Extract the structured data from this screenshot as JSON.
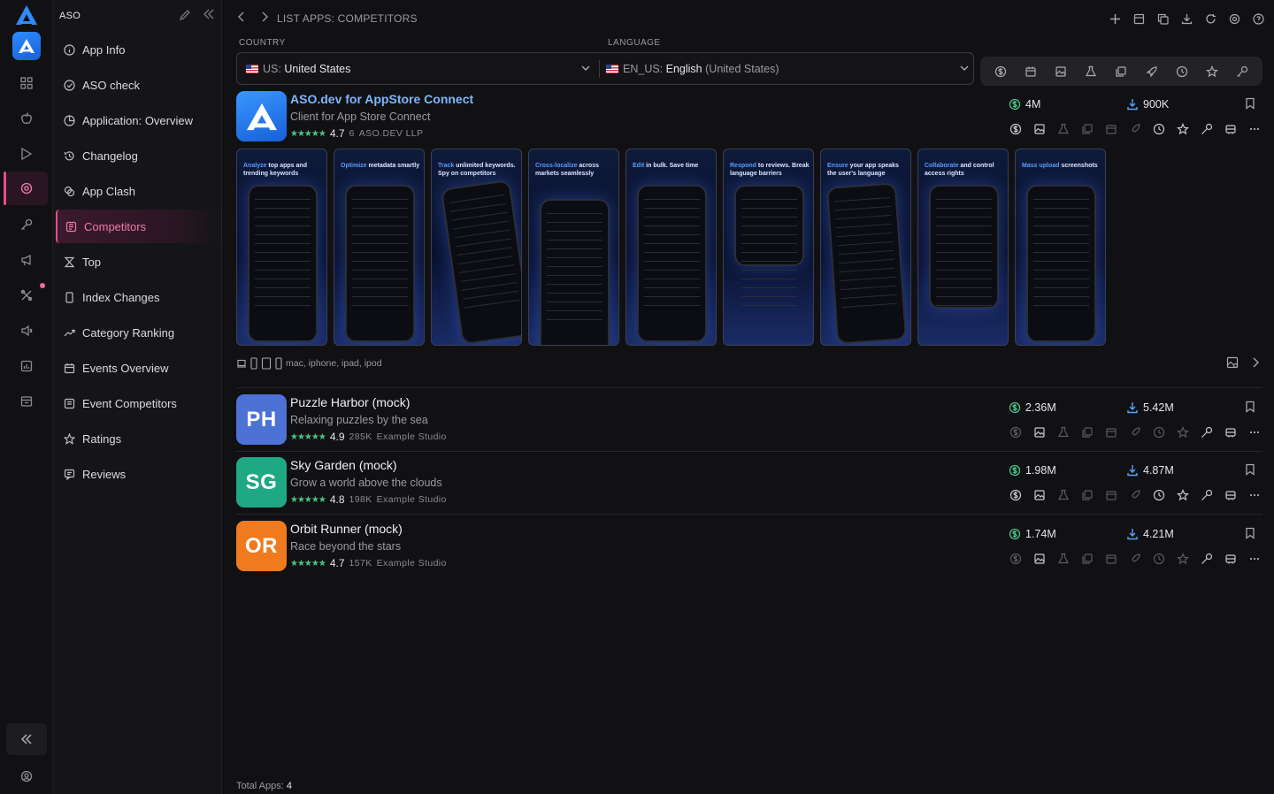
{
  "sidebar": {
    "title": "ASO",
    "items": [
      {
        "label": "App Info",
        "icon": "info-icon",
        "active": false
      },
      {
        "label": "ASO check",
        "icon": "check-circle-icon",
        "active": false
      },
      {
        "label": "Application: Overview",
        "icon": "pie-chart-icon",
        "active": false
      },
      {
        "label": "Changelog",
        "icon": "history-icon",
        "active": false
      },
      {
        "label": "App Clash",
        "icon": "versus-icon",
        "active": false
      },
      {
        "label": "Competitors",
        "icon": "competitors-icon",
        "active": true
      },
      {
        "label": "Top",
        "icon": "trophy-icon",
        "active": false
      },
      {
        "label": "Index Changes",
        "icon": "phone-icon",
        "active": false
      },
      {
        "label": "Category Ranking",
        "icon": "trend-icon",
        "active": false
      },
      {
        "label": "Events Overview",
        "icon": "calendar-icon",
        "active": false
      },
      {
        "label": "Event Competitors",
        "icon": "calendar-compare-icon",
        "active": false
      },
      {
        "label": "Ratings",
        "icon": "star-icon",
        "active": false
      },
      {
        "label": "Reviews",
        "icon": "review-icon",
        "active": false
      }
    ]
  },
  "header": {
    "breadcrumb": "LIST APPS: COMPETITORS"
  },
  "filters": {
    "country_label": "COUNTRY",
    "language_label": "LANGUAGE",
    "country_code": "US:",
    "country_value": "United States",
    "language_code": "EN_US:",
    "language_value": "English",
    "language_region": "(United States)"
  },
  "apps": [
    {
      "initials": "",
      "name": "ASO.dev for AppStore Connect",
      "subtitle": "Client for App Store Connect",
      "stars": "★★★★★",
      "rating": "4.7",
      "reviews": "6",
      "developer": "ASO.DEV LLP",
      "revenue": "4M",
      "downloads": "900K",
      "color": "#1e6fe6"
    },
    {
      "initials": "PH",
      "name": "Puzzle Harbor (mock)",
      "subtitle": "Relaxing puzzles by the sea",
      "stars": "★★★★★",
      "rating": "4.9",
      "reviews": "285K",
      "developer": "Example Studio",
      "revenue": "2.36M",
      "downloads": "5.42M",
      "color": "#4d72d6"
    },
    {
      "initials": "SG",
      "name": "Sky Garden (mock)",
      "subtitle": "Grow a world above the clouds",
      "stars": "★★★★★",
      "rating": "4.8",
      "reviews": "198K",
      "developer": "Example Studio",
      "revenue": "1.98M",
      "downloads": "4.87M",
      "color": "#1fa884"
    },
    {
      "initials": "OR",
      "name": "Orbit Runner (mock)",
      "subtitle": "Race beyond the stars",
      "stars": "★★★★★",
      "rating": "4.7",
      "reviews": "157K",
      "developer": "Example Studio",
      "revenue": "1.74M",
      "downloads": "4.21M",
      "color": "#f07a1e"
    }
  ],
  "screenshots": [
    {
      "pre": "Analyze",
      "rest": " top apps and trending keywords"
    },
    {
      "pre": "Optimize",
      "rest": " metadata smartly"
    },
    {
      "pre": "Track",
      "rest": " unlimited keywords. Spy on competitors"
    },
    {
      "pre": "Cross-localize",
      "rest": " across markets seamlessly"
    },
    {
      "pre": "Edit",
      "rest": " in bulk. Save time"
    },
    {
      "pre": "Respond",
      "rest": " to reviews. Break language barriers"
    },
    {
      "pre": "Ensure",
      "rest": " your app speaks the user's language"
    },
    {
      "pre": "Collaborate",
      "rest": " and control access rights"
    },
    {
      "pre": "Mass upload",
      "rest": " screenshots"
    }
  ],
  "devices_text": "mac, iphone, ipad, ipod",
  "footer": {
    "label": "Total Apps:",
    "count": "4"
  },
  "colors": {
    "accent": "#e04f8c",
    "revenue_icon": "#4cc28a",
    "download_icon": "#5aa0ff"
  }
}
